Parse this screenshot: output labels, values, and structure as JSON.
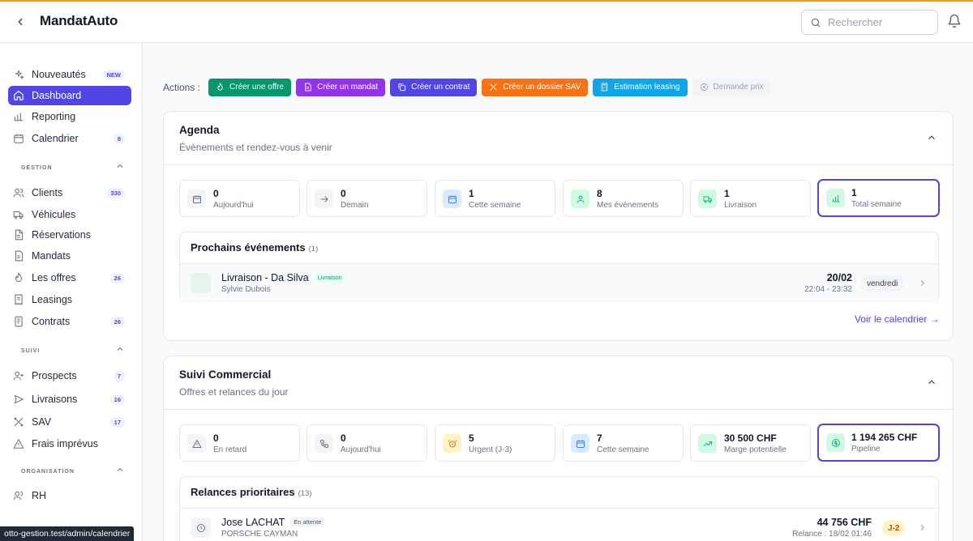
{
  "app": {
    "title": "MandatAuto"
  },
  "search": {
    "placeholder": "Rechercher"
  },
  "sidebar": {
    "top": [
      {
        "label": "Nouveautés",
        "badge": "NEW"
      },
      {
        "label": "Dashboard",
        "active": true
      },
      {
        "label": "Reporting"
      },
      {
        "label": "Calendrier",
        "badge": "8"
      }
    ],
    "sections": {
      "gestion": "GESTION",
      "suivi": "SUIVI",
      "organisation": "ORGANISATION"
    },
    "gestion": [
      {
        "label": "Clients",
        "badge": "330"
      },
      {
        "label": "Véhicules"
      },
      {
        "label": "Réservations"
      },
      {
        "label": "Mandats"
      },
      {
        "label": "Les offres",
        "badge": "26"
      },
      {
        "label": "Leasings"
      },
      {
        "label": "Contrats",
        "badge": "26"
      }
    ],
    "suivi": [
      {
        "label": "Prospects",
        "badge": "7"
      },
      {
        "label": "Livraisons",
        "badge": "16"
      },
      {
        "label": "SAV",
        "badge": "17"
      },
      {
        "label": "Frais imprévus"
      }
    ],
    "organisation": [
      {
        "label": "RH"
      }
    ]
  },
  "actions": {
    "label": "Actions :",
    "buttons": [
      {
        "label": "Créer une offre",
        "color": "#059669"
      },
      {
        "label": "Créer un mandat",
        "color": "#9333ea"
      },
      {
        "label": "Créer un contrat",
        "color": "#4f46e5"
      },
      {
        "label": "Créer un dossier SAV",
        "color": "#f97316"
      },
      {
        "label": "Estimation leasing",
        "color": "#0ea5e9"
      },
      {
        "label": "Demande prix",
        "color": "#f3f4f6"
      }
    ]
  },
  "agenda": {
    "title": "Agenda",
    "subtitle": "Événements et rendez-vous à venir",
    "stats": [
      {
        "value": "0",
        "label": "Aujourd'hui"
      },
      {
        "value": "0",
        "label": "Demain"
      },
      {
        "value": "1",
        "label": "Cette semaine"
      },
      {
        "value": "8",
        "label": "Mes événements"
      },
      {
        "value": "1",
        "label": "Livraison"
      },
      {
        "value": "1",
        "label": "Total semaine"
      }
    ],
    "upcoming": {
      "title": "Prochains événements",
      "count": "(1)",
      "items": [
        {
          "title": "Livraison - Da Silva",
          "tag": "Livraison",
          "person": "Sylvie Dubois",
          "date": "20/02",
          "time": "22:04 - 23:32",
          "day": "vendredi"
        }
      ]
    },
    "link": "Voir le calendrier →"
  },
  "suivi_commercial": {
    "title": "Suivi Commercial",
    "subtitle": "Offres et relances du jour",
    "stats": [
      {
        "value": "0",
        "label": "En retard"
      },
      {
        "value": "0",
        "label": "Aujourd'hui"
      },
      {
        "value": "5",
        "label": "Urgent (J-3)"
      },
      {
        "value": "7",
        "label": "Cette semaine"
      },
      {
        "value": "30 500 CHF",
        "label": "Marge potentielle"
      },
      {
        "value": "1 194 265 CHF",
        "label": "Pipeline"
      }
    ],
    "relances": {
      "title": "Relances prioritaires",
      "count": "(13)",
      "items": [
        {
          "name": "Jose LACHAT",
          "status": "En attente",
          "vehicle": "PORSCHE CAYMAN",
          "amount": "44 756 CHF",
          "relance": "Relance : 18/02 01:46",
          "due": "J-2"
        }
      ]
    }
  },
  "status_url": "otto-gestion.test/admin/calendrier"
}
